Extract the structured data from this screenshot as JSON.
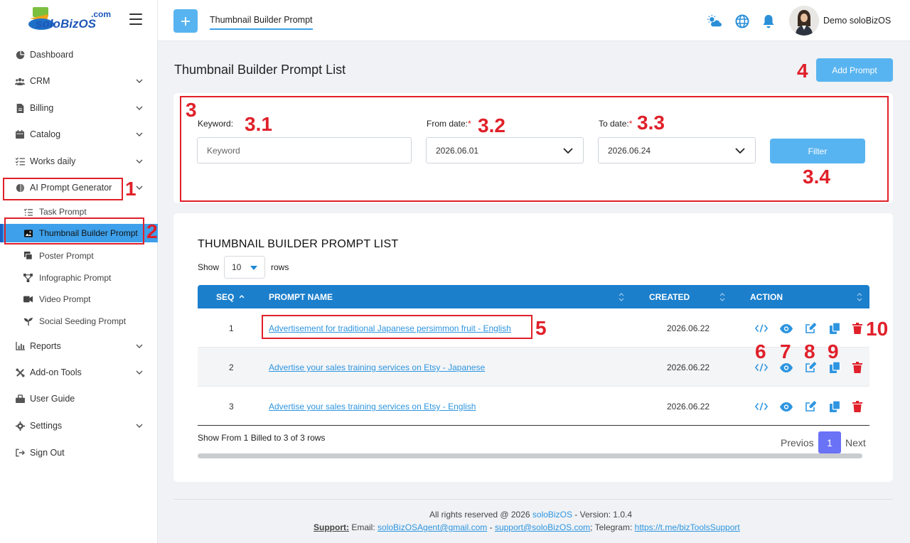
{
  "brand": {
    "logo_text": "soloBizOS",
    "logo_suffix": ".com"
  },
  "header": {
    "tab_title": "Thumbnail Builder Prompt",
    "user_name": "Demo soloBizOS"
  },
  "sidebar": {
    "items": [
      {
        "label": "Dashboard",
        "icon": "pie-chart-icon"
      },
      {
        "label": "CRM",
        "icon": "users-icon"
      },
      {
        "label": "Billing",
        "icon": "invoice-icon"
      },
      {
        "label": "Catalog",
        "icon": "calendar-icon"
      },
      {
        "label": "Works daily",
        "icon": "checklist-icon"
      },
      {
        "label": "AI Prompt Generator",
        "icon": "brain-icon"
      },
      {
        "label": "Reports",
        "icon": "chart-icon"
      },
      {
        "label": "Add-on Tools",
        "icon": "tools-icon"
      },
      {
        "label": "User Guide",
        "icon": "guide-icon"
      },
      {
        "label": "Settings",
        "icon": "gear-icon"
      },
      {
        "label": "Sign Out",
        "icon": "sign-out-icon"
      }
    ],
    "sub_items": [
      {
        "label": "Task Prompt"
      },
      {
        "label": "Thumbnail Builder Prompt"
      },
      {
        "label": "Poster Prompt"
      },
      {
        "label": "Infographic Prompt"
      },
      {
        "label": "Video Prompt"
      },
      {
        "label": "Social Seeding Prompt"
      }
    ]
  },
  "page": {
    "title": "Thumbnail Builder Prompt List",
    "add_button": "Add Prompt"
  },
  "filter": {
    "keyword_label": "Keyword:",
    "keyword_placeholder": "Keyword",
    "from_label": "From date:",
    "from_value": "2026.06.01",
    "to_label": "To date:",
    "to_value": "2026.06.24",
    "required_mark": "*",
    "filter_button": "Filter"
  },
  "list": {
    "title": "THUMBNAIL BUILDER PROMPT LIST",
    "show_label": "Show",
    "rows_value": "10",
    "rows_label": "rows",
    "columns": [
      "SEQ",
      "PROMPT NAME",
      "CREATED",
      "ACTION"
    ],
    "rows": [
      {
        "seq": "1",
        "name": "Advertisement for traditional Japanese persimmon fruit - English",
        "created": "2026.06.22"
      },
      {
        "seq": "2",
        "name": "Advertise your sales training services on Etsy - Japanese",
        "created": "2026.06.22"
      },
      {
        "seq": "3",
        "name": "Advertise your sales training services on Etsy - English",
        "created": "2026.06.22"
      }
    ],
    "info": "Show From 1 Billed to 3 of 3 rows",
    "prev": "Previos",
    "page": "1",
    "next": "Next"
  },
  "footer": {
    "rights_prefix": "All rights reserved @ 2026 ",
    "rights_brand": "soloBizOS",
    "rights_suffix": " - Version: 1.0.4",
    "support_label": "Support:",
    "email_label": " Email: ",
    "email1": "soloBizOSAgent@gmail.com",
    "sep": " - ",
    "email2": "support@soloBizOS.com",
    "telegram_label": "; Telegram: ",
    "telegram": "https://t.me/bizToolsSupport"
  },
  "annotations": [
    "1",
    "2",
    "3",
    "3.1",
    "3.2",
    "3.3",
    "3.4",
    "4",
    "5",
    "6",
    "7",
    "8",
    "9",
    "10"
  ],
  "colors": {
    "primary": "#1b7fcc",
    "button": "#58b4f0",
    "link": "#2e95e0",
    "delete": "#e0202a",
    "annotation": "#e0202a",
    "pager": "#6a72f6"
  }
}
